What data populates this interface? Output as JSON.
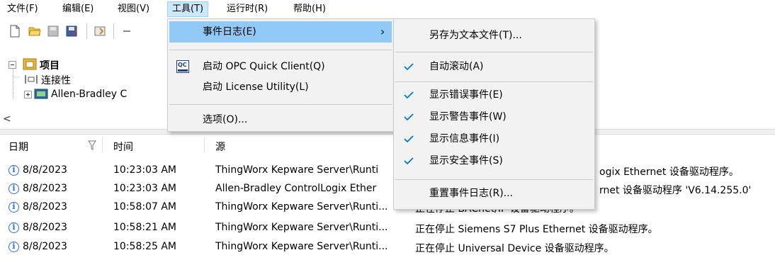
{
  "menubar": {
    "items": [
      {
        "label": "文件(F)"
      },
      {
        "label": "编辑(E)"
      },
      {
        "label": "视图(V)"
      },
      {
        "label": "工具(T)"
      },
      {
        "label": "运行时(R)"
      },
      {
        "label": "帮助(H)"
      }
    ]
  },
  "tree": {
    "root_label": "项目",
    "connectivity_label": "连接性",
    "channel_label": "Allen-Bradley C"
  },
  "log": {
    "headers": {
      "date": "日期",
      "time": "时间",
      "source": "源"
    },
    "rows": [
      {
        "date": "8/8/2023",
        "time": "10:23:03 AM",
        "source": "ThingWorx Kepware Server\\Runti",
        "event": "ogix Ethernet 设备驱动程序。"
      },
      {
        "date": "8/8/2023",
        "time": "10:23:03 AM",
        "source": "Allen-Bradley ControlLogix Ether",
        "event": "rnet 设备驱动程序 'V6.14.255.0'"
      },
      {
        "date": "8/8/2023",
        "time": "10:58:07 AM",
        "source": "ThingWorx Kepware Server\\Runti...",
        "event": "正在停止 BACnet/IP 设备驱动程序。"
      },
      {
        "date": "8/8/2023",
        "time": "10:58:21 AM",
        "source": "ThingWorx Kepware Server\\Runti...",
        "event": "正在停止 Siemens S7 Plus Ethernet 设备驱动程序。"
      },
      {
        "date": "8/8/2023",
        "time": "10:58:25 AM",
        "source": "ThingWorx Kepware Server\\Runti...",
        "event": "正在停止 Universal Device 设备驱动程序。"
      }
    ]
  },
  "tools_menu": {
    "event_log": "事件日志(E)",
    "submenu_arrow": "›",
    "opc_icon_text": "QC",
    "opc_quick_client": "启动 OPC Quick Client(Q)",
    "license_utility": "启动 License Utility(L)",
    "options": "选项(O)..."
  },
  "event_log_submenu": {
    "save_as_text": "另存为文本文件(T)...",
    "auto_scroll": "自动滚动(A)",
    "show_errors": "显示错误事件(E)",
    "show_warnings": "显示警告事件(W)",
    "show_info": "显示信息事件(I)",
    "show_security": "显示安全事件(S)",
    "reset": "重置事件日志(R)..."
  },
  "colors": {
    "accent": "#0078d7",
    "highlight": "#cce8ff",
    "folder": "#e8b73a"
  }
}
